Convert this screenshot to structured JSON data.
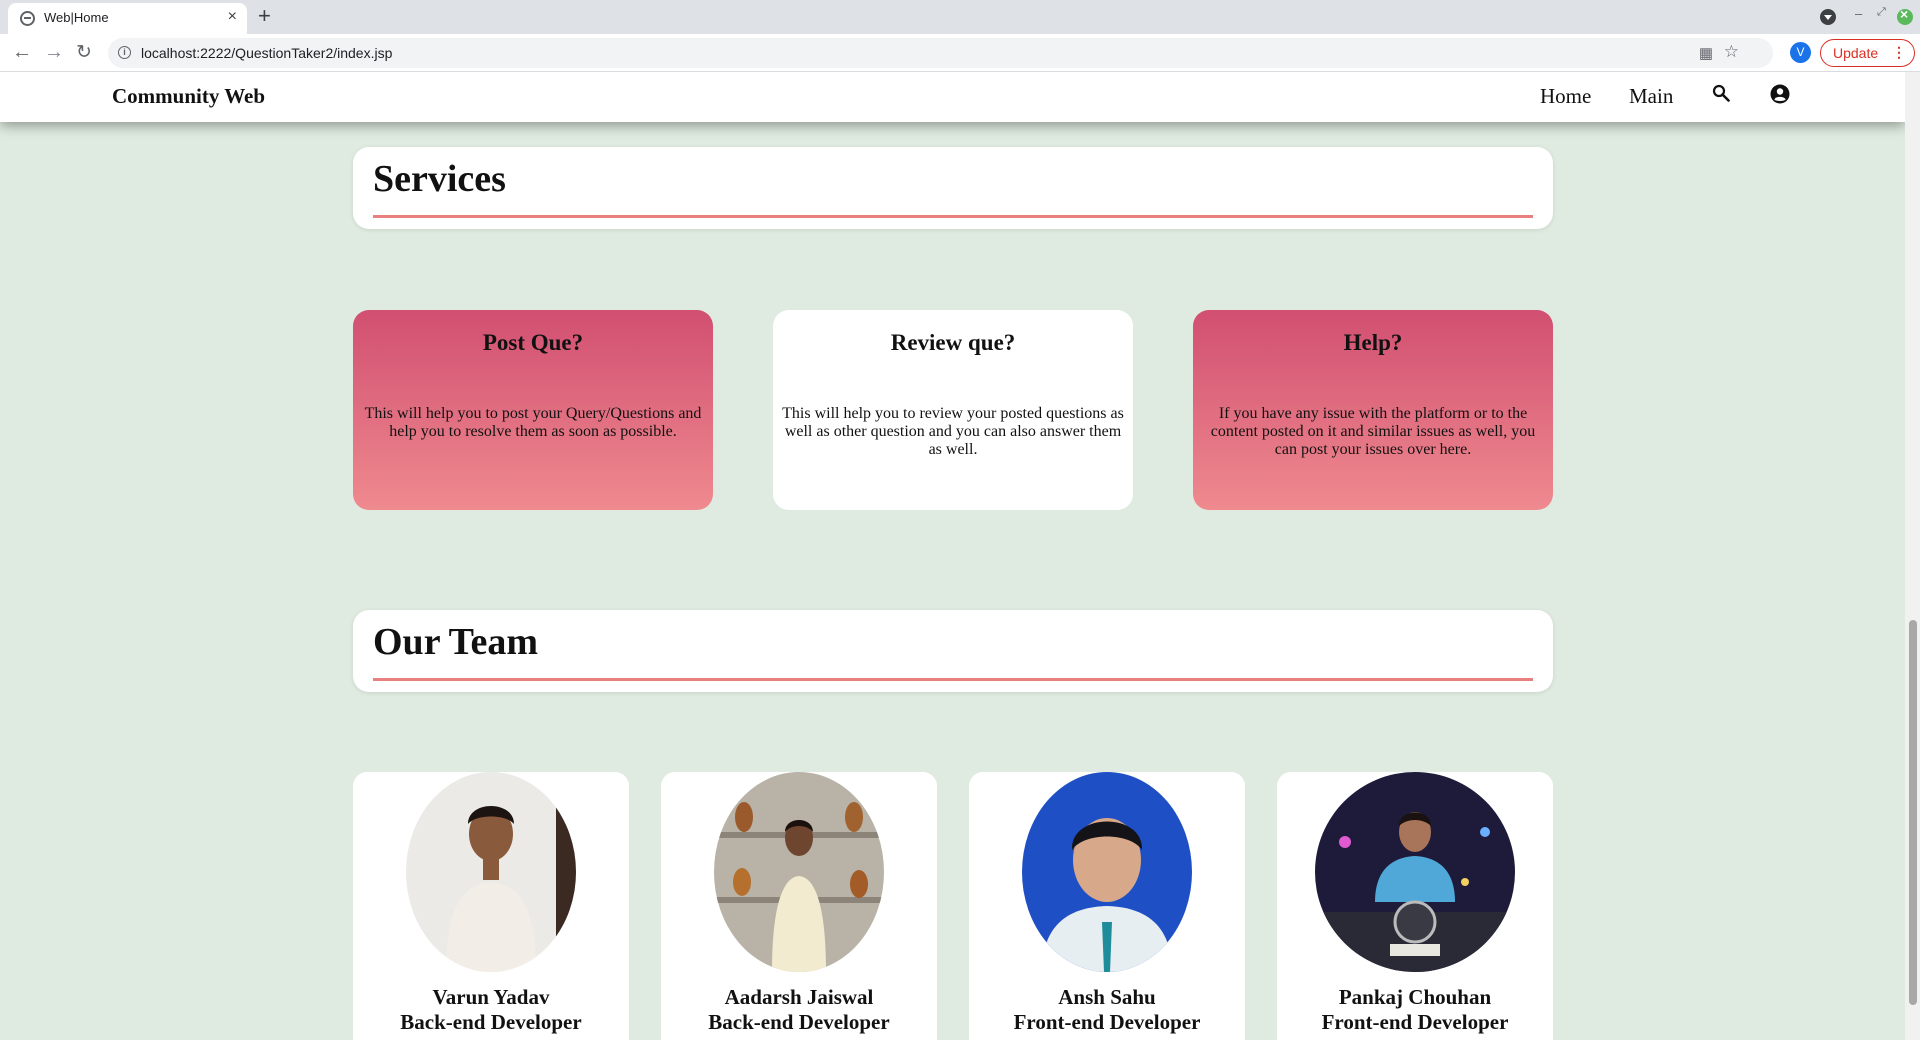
{
  "browser": {
    "tab_title": "Web|Home",
    "tab_close": "×",
    "new_tab": "+",
    "url": "localhost:2222/QuestionTaker2/index.jsp",
    "profile_initial": "V",
    "update_label": "Update",
    "update_menu": "⋮",
    "back": "←",
    "forward": "→",
    "reload": "↻",
    "window_minimize": "–",
    "window_maximize": "⤢",
    "star": "☆",
    "qr": "▦",
    "info": "i"
  },
  "site_nav": {
    "brand": "Community Web",
    "links": [
      "Home",
      "Main"
    ]
  },
  "services": {
    "heading": "Services",
    "cards": [
      {
        "title": "Post Que?",
        "text": "This will help you to post your Query/Questions and help you to resolve them as soon as possible."
      },
      {
        "title": "Review que?",
        "text": "This will help you to review your posted questions as well as other question and you can also answer them as well."
      },
      {
        "title": "Help?",
        "text": "If you have any issue with the platform or to the content posted on it and similar issues as well, you can post your issues over here."
      }
    ]
  },
  "team": {
    "heading": "Our Team",
    "members": [
      {
        "name": "Varun Yadav",
        "role": "Back-end Developer"
      },
      {
        "name": "Aadarsh Jaiswal",
        "role": "Back-end Developer"
      },
      {
        "name": "Ansh Sahu",
        "role": "Front-end Developer"
      },
      {
        "name": "Pankaj Chouhan",
        "role": "Front-end Developer"
      }
    ]
  },
  "colors": {
    "page_bg": "#dfebe0",
    "accent_line": "#e88080",
    "card_pink_top": "#d14f71",
    "card_pink_bottom": "#ef8a8f"
  },
  "icons": [
    "globe-icon",
    "search-icon",
    "account-icon",
    "star-icon",
    "qr-icon"
  ]
}
